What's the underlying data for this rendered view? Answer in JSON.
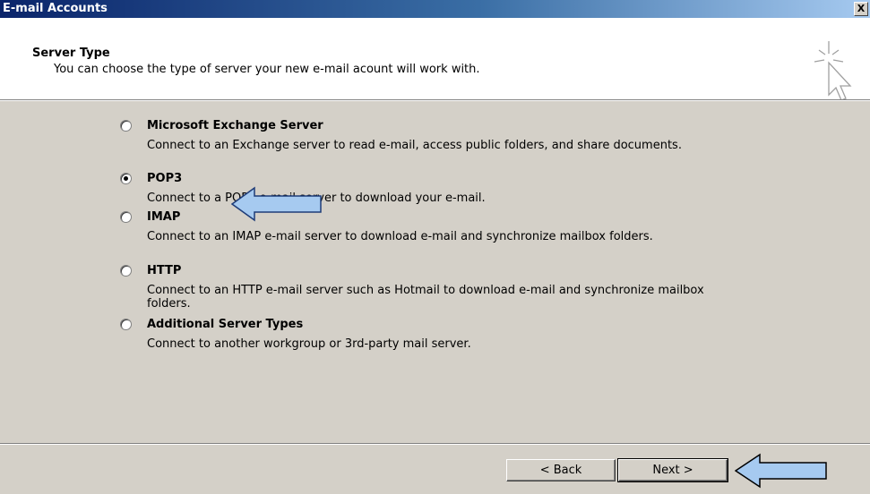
{
  "window": {
    "title": "E-mail Accounts",
    "close_label": "X"
  },
  "header": {
    "title": "Server Type",
    "subtitle": "You can choose the type of server your new e-mail acount will work with."
  },
  "options": [
    {
      "label": "Microsoft Exchange Server",
      "description": "Connect to an Exchange server to read e-mail, access public folders, and share documents.",
      "checked": false
    },
    {
      "label": "POP3",
      "description": "Connect to a POP3 e-mail server to download your e-mail.",
      "checked": true
    },
    {
      "label": "IMAP",
      "description": "Connect to an IMAP e-mail server to download e-mail and synchronize mailbox folders.",
      "checked": false
    },
    {
      "label": "HTTP",
      "description": "Connect to an HTTP e-mail server such as Hotmail to download e-mail and synchronize mailbox folders.",
      "checked": false
    },
    {
      "label": "Additional Server Types",
      "description": "Connect to another workgroup or 3rd-party mail server.",
      "checked": false
    }
  ],
  "buttons": {
    "back": "< Back",
    "next": "Next >"
  },
  "colors": {
    "title_bar_start": "#0a246a",
    "title_bar_end": "#a6caf0",
    "dialog_bg": "#d4d0c8",
    "annotation_arrow": "#a6caf0"
  },
  "icons": {
    "wizard": "wizard-cursor-sparkle-icon",
    "annotation": "left-arrow-annotation-icon"
  }
}
